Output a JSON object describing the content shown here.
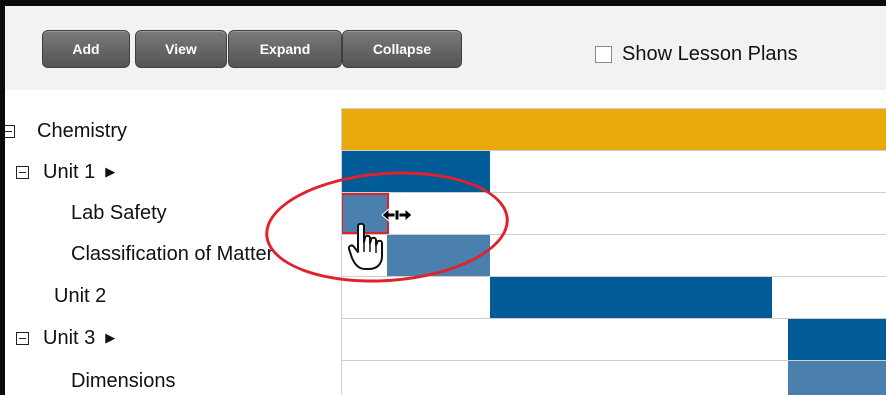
{
  "toolbar": {
    "buttons": [
      "Add",
      "View",
      "Expand",
      "Collapse"
    ],
    "show_lesson_plans": {
      "label": "Show Lesson Plans",
      "checked": false
    }
  },
  "tree": {
    "course": {
      "label": "Chemistry",
      "expanded": true
    },
    "unit1": {
      "label": "Unit 1",
      "expanded": true,
      "has_arrow": true
    },
    "lesson1": {
      "label": "Lab Safety"
    },
    "lesson2": {
      "label": "Classification of Matter"
    },
    "unit2": {
      "label": "Unit 2",
      "expanded": false
    },
    "unit3": {
      "label": "Unit 3",
      "expanded": true,
      "has_arrow": true
    },
    "lesson3": {
      "label": "Dimensions"
    }
  },
  "colors": {
    "course_bar": "#e7a90c",
    "unit_bar": "#005b96",
    "lesson_bar": "#4a7fae",
    "selection_outline": "#e2222b",
    "button_dark": "#5a5a5a"
  },
  "icons": [
    "toggle-box-icon",
    "expand-arrow-icon",
    "checkbox-icon",
    "resize-cursor-icon",
    "hand-cursor-icon"
  ]
}
